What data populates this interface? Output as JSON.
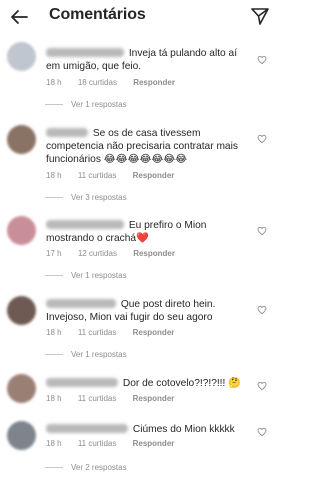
{
  "header": {
    "title": "Comentários",
    "back_icon": "arrow-left-icon",
    "send_icon": "paper-plane-icon"
  },
  "comments": [
    {
      "text": "Inveja tá pulando alto aí em umigão, que feio.",
      "time": "18 h",
      "likes": "18 curtidas",
      "reply": "Responder",
      "replies": "Ver 1 respostas",
      "avatar_color": "#bfc6cf"
    },
    {
      "text": "Se os de casa tivessem competencia não precisaria contratar mais funcionários 😂😂😂😂😂😂😂",
      "time": "18 h",
      "likes": "11 curtidas",
      "reply": "Responder",
      "replies": "Ver 3 respostas",
      "avatar_color": "#8a7264"
    },
    {
      "text": "Eu prefiro o Mion mostrando o crachá❤️",
      "time": "17 h",
      "likes": "12 curtidas",
      "reply": "Responder",
      "replies": "Ver 1 respostas",
      "avatar_color": "#c98f98"
    },
    {
      "text": "Que post direto hein. Invejoso, Mion vai fugir do seu agoro",
      "time": "18 h",
      "likes": "11 curtidas",
      "reply": "Responder",
      "replies": "Ver 1 respostas",
      "avatar_color": "#6e5a52"
    },
    {
      "text": "Dor de cotovelo?!?!?!!! 🤔",
      "time": "18 h",
      "likes": "11 curtidas",
      "reply": "Responder",
      "replies": "",
      "avatar_color": "#9a7f74"
    },
    {
      "text": "Ciúmes do Mion kkkkk",
      "time": "18 h",
      "likes": "11 curtidas",
      "reply": "Responder",
      "replies": "Ver 2 respostas",
      "avatar_color": "#7d848c"
    }
  ]
}
